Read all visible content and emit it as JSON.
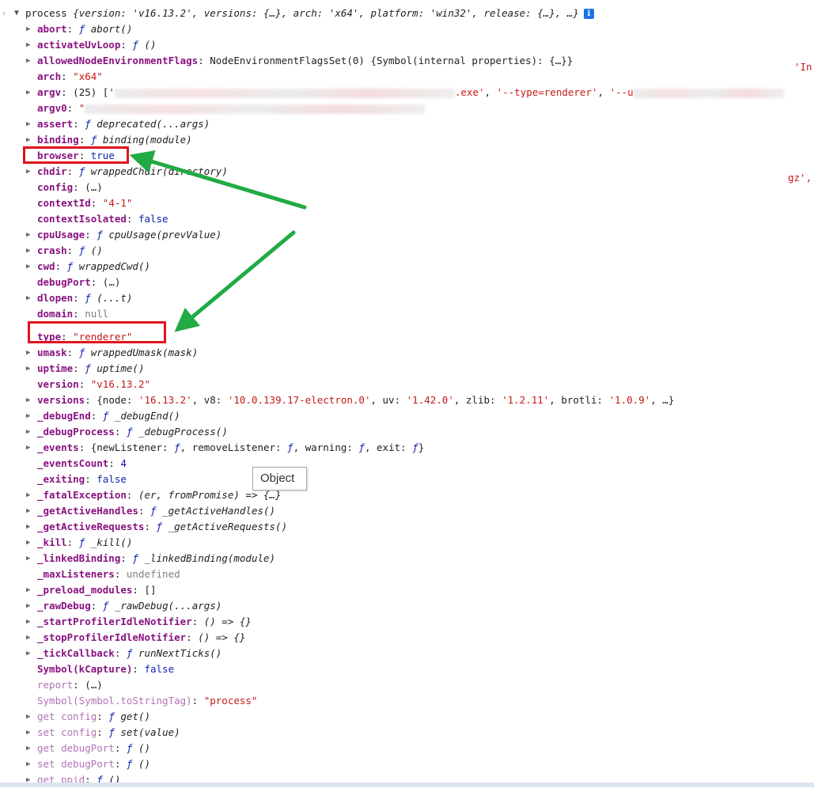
{
  "header": {
    "prefix": "process ",
    "summary_text": "{version: 'v16.13.2', versions: {…}, arch: 'x64', platform: 'win32', release: {…}, …}",
    "info_icon_glyph": "i"
  },
  "rows": [
    {
      "key": "abort",
      "tri": true,
      "v": [
        {
          "c": "func-f",
          "t": "ƒ "
        },
        {
          "c": "func-sig",
          "t": "abort()"
        }
      ]
    },
    {
      "key": "activateUvLoop",
      "tri": true,
      "v": [
        {
          "c": "func-f",
          "t": "ƒ "
        },
        {
          "c": "func-sig",
          "t": "()"
        }
      ]
    },
    {
      "key": "allowedNodeEnvironmentFlags",
      "tri": true,
      "v": [
        {
          "c": "plain",
          "t": "NodeEnvironmentFlagsSet(0) {Symbol(internal properties): {…}}"
        }
      ]
    },
    {
      "key": "arch",
      "tri": false,
      "v": [
        {
          "c": "str",
          "t": "\"x64\""
        }
      ]
    },
    {
      "key": "argv",
      "tri": true,
      "v": [
        {
          "c": "plain",
          "t": "(25) ['"
        },
        {
          "c": "blur",
          "w": 430
        },
        {
          "c": "str",
          "t": ".exe'"
        },
        {
          "c": "plain",
          "t": ", "
        },
        {
          "c": "str",
          "t": "'--type=renderer'"
        },
        {
          "c": "plain",
          "t": ", "
        },
        {
          "c": "str",
          "t": "'--u"
        },
        {
          "c": "blur",
          "w": 190
        }
      ]
    },
    {
      "key": "argv0",
      "tri": false,
      "v": [
        {
          "c": "str",
          "t": "\""
        },
        {
          "c": "blur",
          "w": 430
        }
      ]
    },
    {
      "key": "assert",
      "tri": true,
      "v": [
        {
          "c": "func-f",
          "t": "ƒ "
        },
        {
          "c": "func-sig",
          "t": "deprecated(...args)"
        }
      ]
    },
    {
      "key": "binding",
      "tri": true,
      "v": [
        {
          "c": "func-f",
          "t": "ƒ "
        },
        {
          "c": "func-sig",
          "t": "binding(module)"
        }
      ]
    },
    {
      "key": "browser",
      "tri": false,
      "v": [
        {
          "c": "kw",
          "t": "true"
        }
      ]
    },
    {
      "key": "chdir",
      "tri": true,
      "v": [
        {
          "c": "func-f",
          "t": "ƒ "
        },
        {
          "c": "func-sig",
          "t": "wrappedChdir(directory)"
        }
      ]
    },
    {
      "key": "config",
      "tri": false,
      "v": [
        {
          "c": "plain",
          "t": " (…)"
        }
      ]
    },
    {
      "key": "contextId",
      "tri": false,
      "v": [
        {
          "c": "str",
          "t": "\"4-1\""
        }
      ]
    },
    {
      "key": "contextIsolated",
      "tri": false,
      "v": [
        {
          "c": "kw",
          "t": "false"
        }
      ]
    },
    {
      "key": "cpuUsage",
      "tri": true,
      "v": [
        {
          "c": "func-f",
          "t": "ƒ "
        },
        {
          "c": "func-sig",
          "t": "cpuUsage(prevValue)"
        }
      ]
    },
    {
      "key": "crash",
      "tri": true,
      "v": [
        {
          "c": "func-f",
          "t": "ƒ "
        },
        {
          "c": "func-sig",
          "t": "()"
        }
      ]
    },
    {
      "key": "cwd",
      "tri": true,
      "v": [
        {
          "c": "func-f",
          "t": "ƒ "
        },
        {
          "c": "func-sig",
          "t": "wrappedCwd()"
        }
      ]
    },
    {
      "key": "debugPort",
      "tri": false,
      "v": [
        {
          "c": "plain",
          "t": " (…)"
        }
      ]
    },
    {
      "key": "dlopen",
      "tri": true,
      "v": [
        {
          "c": "func-f",
          "t": "ƒ "
        },
        {
          "c": "func-sig",
          "t": "(...t)"
        }
      ]
    },
    {
      "key": "domain",
      "tri": false,
      "v": [
        {
          "c": "nul",
          "t": "null"
        }
      ]
    },
    {
      "key": "type",
      "tri": false,
      "gap": 9,
      "v": [
        {
          "c": "str",
          "t": "\"renderer\""
        }
      ]
    },
    {
      "key": "umask",
      "tri": true,
      "v": [
        {
          "c": "func-f",
          "t": "ƒ "
        },
        {
          "c": "func-sig",
          "t": "wrappedUmask(mask)"
        }
      ]
    },
    {
      "key": "uptime",
      "tri": true,
      "v": [
        {
          "c": "func-f",
          "t": "ƒ "
        },
        {
          "c": "func-sig",
          "t": "uptime()"
        }
      ]
    },
    {
      "key": "version",
      "tri": false,
      "v": [
        {
          "c": "str",
          "t": "\"v16.13.2\""
        }
      ]
    },
    {
      "key": "versions",
      "tri": true,
      "v": [
        {
          "c": "plain",
          "t": "{node: "
        },
        {
          "c": "str",
          "t": "'16.13.2'"
        },
        {
          "c": "plain",
          "t": ", v8: "
        },
        {
          "c": "str",
          "t": "'10.0.139.17-electron.0'"
        },
        {
          "c": "plain",
          "t": ", uv: "
        },
        {
          "c": "str",
          "t": "'1.42.0'"
        },
        {
          "c": "plain",
          "t": ", zlib: "
        },
        {
          "c": "str",
          "t": "'1.2.11'"
        },
        {
          "c": "plain",
          "t": ", brotli: "
        },
        {
          "c": "str",
          "t": "'1.0.9'"
        },
        {
          "c": "plain",
          "t": ", …}"
        }
      ]
    },
    {
      "key": "_debugEnd",
      "tri": true,
      "v": [
        {
          "c": "func-f",
          "t": "ƒ "
        },
        {
          "c": "func-sig",
          "t": "_debugEnd()"
        }
      ]
    },
    {
      "key": "_debugProcess",
      "tri": true,
      "v": [
        {
          "c": "func-f",
          "t": "ƒ "
        },
        {
          "c": "func-sig",
          "t": "_debugProcess()"
        }
      ]
    },
    {
      "key": "_events",
      "tri": true,
      "v": [
        {
          "c": "plain",
          "t": "{newListener: "
        },
        {
          "c": "func-f",
          "t": "ƒ"
        },
        {
          "c": "plain",
          "t": ", removeListener: "
        },
        {
          "c": "func-f",
          "t": "ƒ"
        },
        {
          "c": "plain",
          "t": ", warning: "
        },
        {
          "c": "func-f",
          "t": "ƒ"
        },
        {
          "c": "plain",
          "t": ", exit: "
        },
        {
          "c": "func-f",
          "t": "ƒ"
        },
        {
          "c": "plain",
          "t": "}"
        }
      ]
    },
    {
      "key": "_eventsCount",
      "tri": false,
      "v": [
        {
          "c": "num",
          "t": "4"
        }
      ]
    },
    {
      "key": "_exiting",
      "tri": false,
      "v": [
        {
          "c": "kw",
          "t": "false"
        }
      ]
    },
    {
      "key": "_fatalException",
      "tri": true,
      "v": [
        {
          "c": "func-sig",
          "t": "(er, fromPromise) => {…}"
        }
      ]
    },
    {
      "key": "_getActiveHandles",
      "tri": true,
      "v": [
        {
          "c": "func-f",
          "t": "ƒ "
        },
        {
          "c": "func-sig",
          "t": "_getActiveHandles()"
        }
      ]
    },
    {
      "key": "_getActiveRequests",
      "tri": true,
      "v": [
        {
          "c": "func-f",
          "t": "ƒ "
        },
        {
          "c": "func-sig",
          "t": "_getActiveRequests()"
        }
      ]
    },
    {
      "key": "_kill",
      "tri": true,
      "v": [
        {
          "c": "func-f",
          "t": "ƒ "
        },
        {
          "c": "func-sig",
          "t": "_kill()"
        }
      ]
    },
    {
      "key": "_linkedBinding",
      "tri": true,
      "v": [
        {
          "c": "func-f",
          "t": "ƒ "
        },
        {
          "c": "func-sig",
          "t": "_linkedBinding(module)"
        }
      ]
    },
    {
      "key": "_maxListeners",
      "tri": false,
      "v": [
        {
          "c": "nul",
          "t": "undefined"
        }
      ]
    },
    {
      "key": "_preload_modules",
      "tri": true,
      "v": [
        {
          "c": "plain",
          "t": "[]"
        }
      ]
    },
    {
      "key": "_rawDebug",
      "tri": true,
      "v": [
        {
          "c": "func-f",
          "t": "ƒ "
        },
        {
          "c": "func-sig",
          "t": "_rawDebug(...args)"
        }
      ]
    },
    {
      "key": "_startProfilerIdleNotifier",
      "tri": true,
      "v": [
        {
          "c": "func-sig",
          "t": "() => {}"
        }
      ]
    },
    {
      "key": "_stopProfilerIdleNotifier",
      "tri": true,
      "v": [
        {
          "c": "func-sig",
          "t": "() => {}"
        }
      ]
    },
    {
      "key": "_tickCallback",
      "tri": true,
      "v": [
        {
          "c": "func-f",
          "t": "ƒ "
        },
        {
          "c": "func-sig",
          "t": "runNextTicks()"
        }
      ]
    },
    {
      "key": "Symbol(kCapture)",
      "tri": false,
      "v": [
        {
          "c": "kw",
          "t": "false"
        }
      ]
    },
    {
      "key": "report",
      "tri": false,
      "kc": "k-proto",
      "v": [
        {
          "c": "plain",
          "t": " (…)"
        }
      ]
    },
    {
      "key": "Symbol(Symbol.toStringTag)",
      "tri": false,
      "kc": "k-proto",
      "v": [
        {
          "c": "str",
          "t": "\"process\""
        }
      ]
    },
    {
      "key": "get config",
      "tri": true,
      "kc": "k-proto",
      "v": [
        {
          "c": "func-f",
          "t": "ƒ "
        },
        {
          "c": "func-sig",
          "t": "get()"
        }
      ]
    },
    {
      "key": "set config",
      "tri": true,
      "kc": "k-proto",
      "v": [
        {
          "c": "func-f",
          "t": "ƒ "
        },
        {
          "c": "func-sig",
          "t": "set(value)"
        }
      ]
    },
    {
      "key": "get debugPort",
      "tri": true,
      "kc": "k-proto",
      "v": [
        {
          "c": "func-f",
          "t": "ƒ "
        },
        {
          "c": "func-sig",
          "t": "()"
        }
      ]
    },
    {
      "key": "set debugPort",
      "tri": true,
      "kc": "k-proto",
      "v": [
        {
          "c": "func-f",
          "t": "ƒ "
        },
        {
          "c": "func-sig",
          "t": "()"
        }
      ]
    },
    {
      "key": "get ppid",
      "tri": true,
      "kc": "k-proto",
      "v": [
        {
          "c": "func-f",
          "t": "ƒ "
        },
        {
          "c": "func-sig",
          "t": "()"
        }
      ]
    }
  ],
  "tooltip": {
    "text": "Object"
  },
  "edge_fragments": [
    {
      "text": "'In",
      "style": "str"
    },
    {
      "text": "gz',",
      "style": "str"
    }
  ],
  "colors": {
    "annotation_box": "#e0141e",
    "annotation_arrow": "#22aa44",
    "own_key": "#881280",
    "proto_key": "#b173b5",
    "string": "#c41a16",
    "keyword": "#0d22aa"
  }
}
